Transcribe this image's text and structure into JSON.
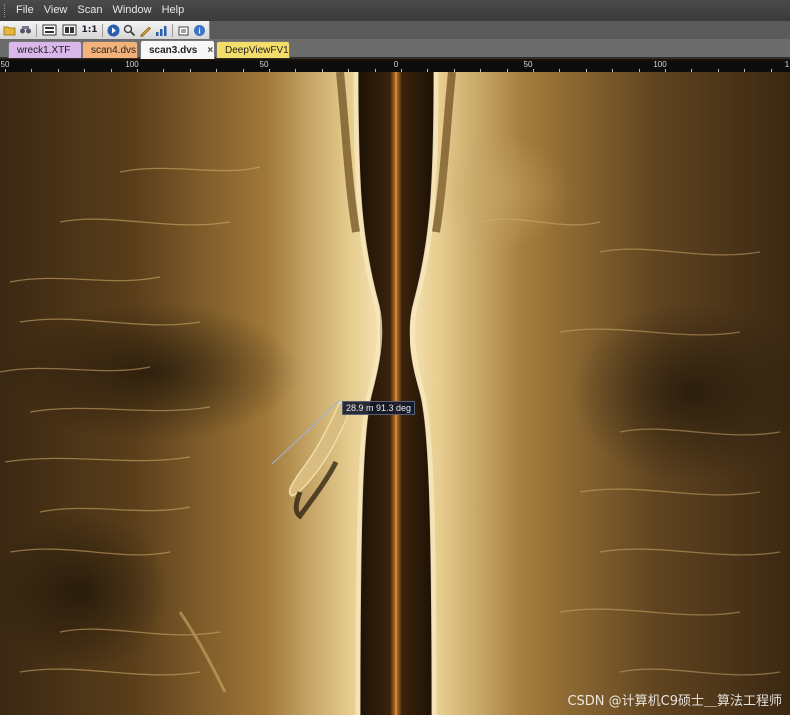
{
  "menu": {
    "items": [
      "File",
      "View",
      "Scan",
      "Window",
      "Help"
    ]
  },
  "toolbar": {
    "buttons": [
      {
        "icon": "open-folder-icon"
      },
      {
        "icon": "binoculars-icon"
      },
      {
        "icon": "fit-view-icon"
      },
      {
        "icon": "fit-width-icon"
      },
      {
        "icon": "actual-size-icon",
        "label": "1:1"
      },
      {
        "icon": "play-icon"
      },
      {
        "icon": "zoom-icon"
      },
      {
        "icon": "measure-pencil-icon"
      },
      {
        "icon": "levels-icon"
      },
      {
        "icon": "export-icon"
      },
      {
        "icon": "info-icon"
      }
    ]
  },
  "tabs": [
    {
      "label": "wreck1.XTF",
      "color": "#d9b7ea",
      "active": false
    },
    {
      "label": "scan4.dvs",
      "color": "#f4b27a",
      "active": false
    },
    {
      "label": "scan3.dvs",
      "color": "#f7f7f7",
      "active": true,
      "close": "×"
    },
    {
      "label": "DeepViewFV1",
      "color": "#f5dd6a",
      "active": false
    }
  ],
  "ruler": {
    "ticks": [
      "50",
      "100",
      "50",
      "0",
      "50",
      "100",
      "1"
    ]
  },
  "measurement": {
    "label": "28.9 m  91.3 deg"
  },
  "watermark": {
    "text": "CSDN @计算机C9硕士＿算法工程师"
  },
  "colors": {
    "sonar_dark": "#2a1c0c",
    "sonar_bright": "#f2dca8",
    "nadir_center": "#c8782a"
  }
}
